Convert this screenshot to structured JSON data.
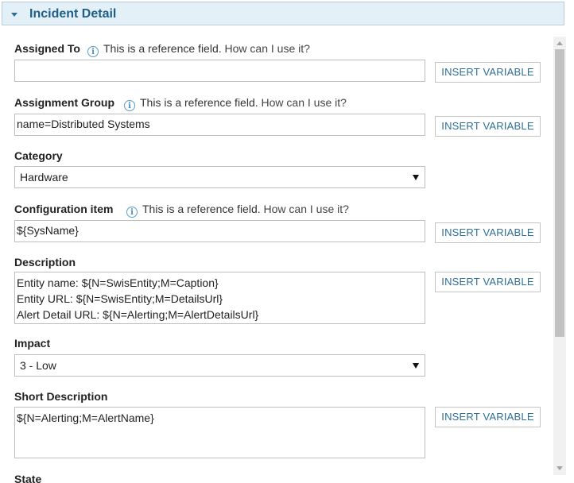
{
  "panel": {
    "title": "Incident Detail"
  },
  "hint": {
    "text": "This is a reference field.",
    "link": "How can I use it?"
  },
  "insert_label": "INSERT VARIABLE",
  "fields": {
    "assigned_to": {
      "label": "Assigned To",
      "value": ""
    },
    "assignment_group": {
      "label": "Assignment Group",
      "value": "name=Distributed Systems"
    },
    "category": {
      "label": "Category",
      "value": "Hardware"
    },
    "configuration_item": {
      "label": "Configuration item",
      "value": "${SysName}"
    },
    "description": {
      "label": "Description",
      "lines": [
        "Entity name: ${N=SwisEntity;M=Caption}",
        "Entity URL: ${N=SwisEntity;M=DetailsUrl}",
        "Alert Detail URL: ${N=Alerting;M=AlertDetailsUrl}"
      ]
    },
    "impact": {
      "label": "Impact",
      "value": "3 - Low"
    },
    "short_description": {
      "label": "Short Description",
      "value": "${N=Alerting;M=AlertName}"
    },
    "state": {
      "label": "State"
    }
  }
}
